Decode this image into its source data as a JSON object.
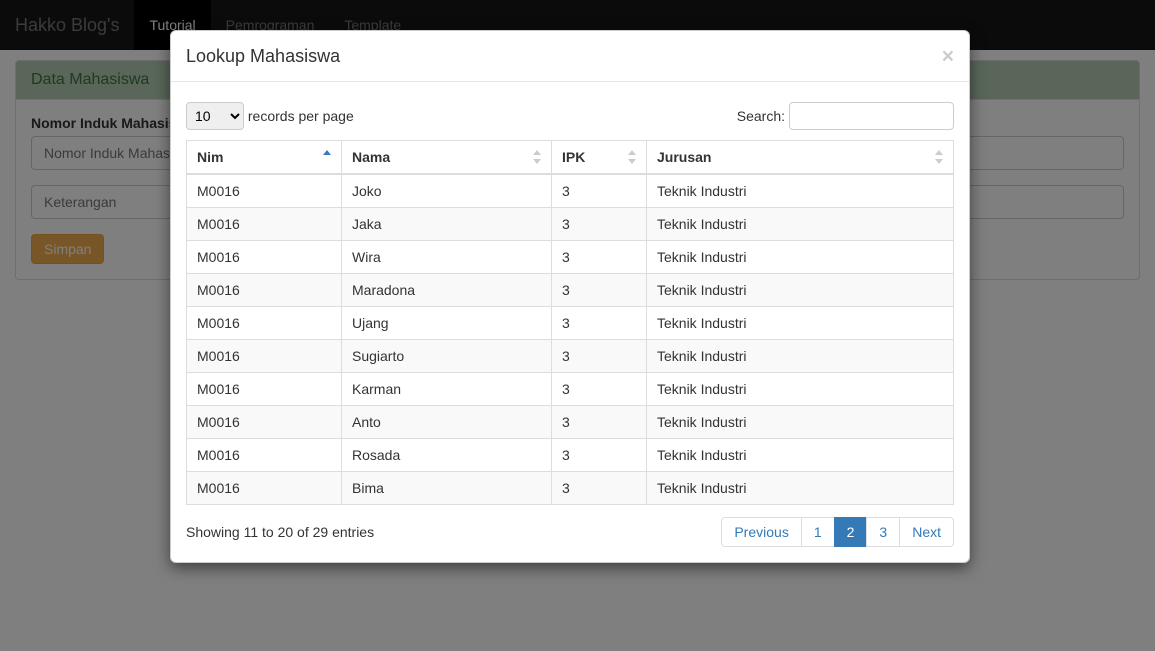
{
  "navbar": {
    "brand": "Hakko Blog's",
    "items": [
      "Tutorial",
      "Pemrograman",
      "Template"
    ],
    "active_index": 0
  },
  "panel": {
    "title": "Data Mahasiswa",
    "nim_label": "Nomor Induk Mahasiswa",
    "nim_placeholder": "Nomor Induk Mahasiswa",
    "ket_placeholder": "Keterangan",
    "submit_label": "Simpan"
  },
  "modal": {
    "title": "Lookup Mahasiswa",
    "records_per_page_label": "records per page",
    "records_select_value": "10",
    "search_label": "Search:",
    "columns": [
      "Nim",
      "Nama",
      "IPK",
      "Jurusan"
    ],
    "rows": [
      {
        "nim": "M0016",
        "nama": "Joko",
        "ipk": "3",
        "jurusan": "Teknik Industri"
      },
      {
        "nim": "M0016",
        "nama": "Jaka",
        "ipk": "3",
        "jurusan": "Teknik Industri"
      },
      {
        "nim": "M0016",
        "nama": "Wira",
        "ipk": "3",
        "jurusan": "Teknik Industri"
      },
      {
        "nim": "M0016",
        "nama": "Maradona",
        "ipk": "3",
        "jurusan": "Teknik Industri"
      },
      {
        "nim": "M0016",
        "nama": "Ujang",
        "ipk": "3",
        "jurusan": "Teknik Industri"
      },
      {
        "nim": "M0016",
        "nama": "Sugiarto",
        "ipk": "3",
        "jurusan": "Teknik Industri"
      },
      {
        "nim": "M0016",
        "nama": "Karman",
        "ipk": "3",
        "jurusan": "Teknik Industri"
      },
      {
        "nim": "M0016",
        "nama": "Anto",
        "ipk": "3",
        "jurusan": "Teknik Industri"
      },
      {
        "nim": "M0016",
        "nama": "Rosada",
        "ipk": "3",
        "jurusan": "Teknik Industri"
      },
      {
        "nim": "M0016",
        "nama": "Bima",
        "ipk": "3",
        "jurusan": "Teknik Industri"
      }
    ],
    "info": "Showing 11 to 20 of 29 entries",
    "pagination": {
      "previous": "Previous",
      "pages": [
        "1",
        "2",
        "3"
      ],
      "active_index": 1,
      "next": "Next"
    }
  }
}
